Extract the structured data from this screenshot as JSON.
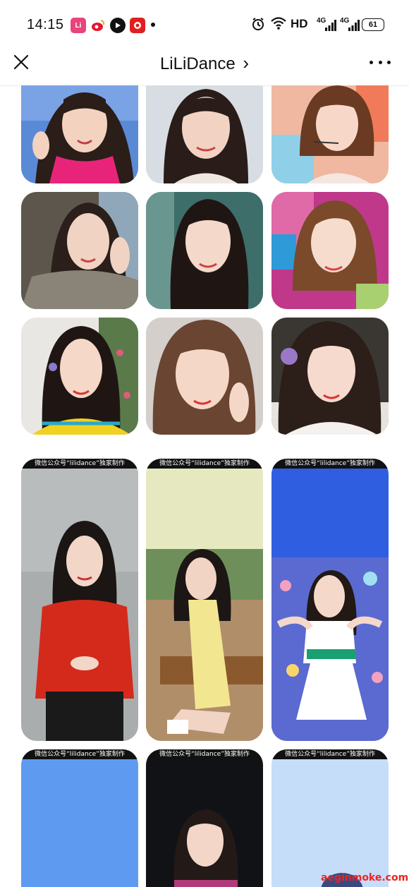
{
  "status_bar": {
    "time": "14:15",
    "hd_label": "HD",
    "network_1": "4G",
    "network_2": "4G",
    "battery": "61"
  },
  "nav": {
    "title": "LiLiDance",
    "title_chevron": "›"
  },
  "poster_watermark": "微信公众号“lilidance”独家制作",
  "site_watermark": "aeginmoke.com",
  "colors": {
    "weibo_red": "#e6162d",
    "app_pink": "#e8457a",
    "poster_red_jacket": "#d42a1c",
    "poster_yellow_dress": "#f3e690",
    "poster_blue_stage": "#2f5fe0"
  }
}
